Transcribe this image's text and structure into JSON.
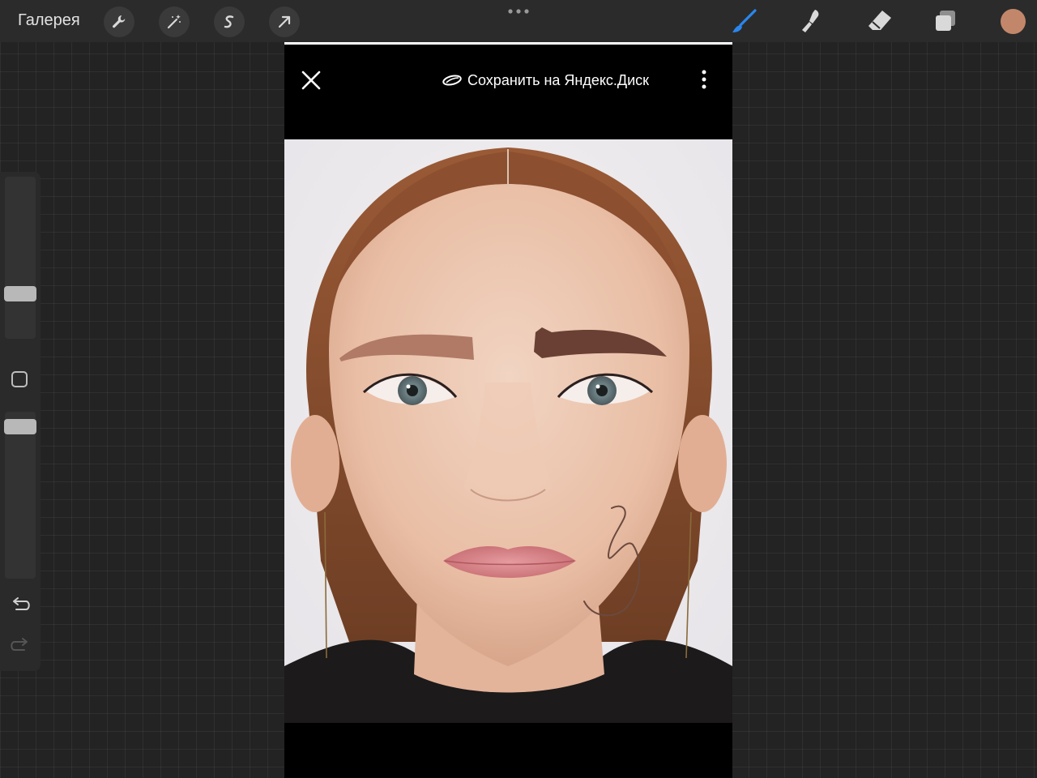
{
  "toolbar": {
    "gallery_label": "Галерея",
    "left_tools": [
      "wrench-icon",
      "magic-wand-icon",
      "selection-s-icon",
      "transform-arrow-icon"
    ],
    "right_tools": [
      "brush-icon",
      "smudge-icon",
      "eraser-icon",
      "layers-icon"
    ],
    "more_icon": "ellipsis-icon",
    "current_color": "#c2876a",
    "active_tool_color": "#1f7ae0"
  },
  "sidebar": {
    "modify_icon": "square-modify-icon",
    "undo_icon": "undo-icon",
    "redo_icon": "redo-icon"
  },
  "viewer": {
    "close_icon": "close-icon",
    "save_label": "Сохранить на Яндекс.Диск",
    "save_icon": "yandex-disk-icon",
    "menu_icon": "vertical-dots-icon"
  },
  "photo": {
    "subject": "portrait",
    "brow_left_color": "#b07a66",
    "brow_right_color": "#6a4034",
    "sketch_color": "#6b4a3e"
  }
}
